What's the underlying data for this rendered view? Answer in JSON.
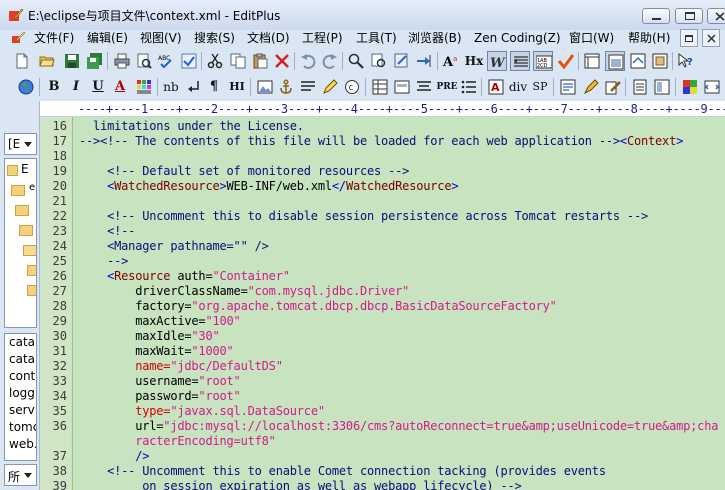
{
  "window": {
    "title": "E:\\eclipse与项目文件\\context.xml - EditPlus"
  },
  "menu": [
    "文件(F)",
    "编辑(E)",
    "视图(V)",
    "搜索(S)",
    "文档(D)",
    "工程(P)",
    "工具(T)",
    "浏览器(B)",
    "Zen Coding(Z)",
    "窗口(W)",
    "帮助(H)"
  ],
  "toolbar2_text": {
    "bold": "B",
    "italic": "I",
    "underline": "U",
    "nb": "nb",
    "para": "¶",
    "hi": "HI",
    "pre": "PRE",
    "div": "div",
    "sp": "SP",
    "hx": "Hx",
    "a": "A"
  },
  "left_panel": {
    "drive_combo": "[E",
    "filter_combo": "所",
    "tree_items": [
      "E",
      "e",
      "",
      "",
      "",
      "",
      ""
    ],
    "files": [
      "catal",
      "catal",
      "cont",
      "logg",
      "serv",
      "tomc",
      "web."
    ]
  },
  "ruler": "----+----1----+----2----+----3----+----4----+----5----+----6----+----7----+----8----+----9----",
  "editor": {
    "lines": [
      {
        "n": "16",
        "segs": [
          {
            "c": "c-com",
            "t": "  limitations under the License."
          }
        ]
      },
      {
        "n": "17",
        "segs": [
          {
            "c": "c-com",
            "t": "--><!-- The contents of this file will be loaded for each web application -->"
          },
          {
            "c": "c-brk",
            "t": "<"
          },
          {
            "c": "c-tag",
            "t": "Context"
          },
          {
            "c": "c-brk",
            "t": ">"
          }
        ]
      },
      {
        "n": "18",
        "segs": []
      },
      {
        "n": "19",
        "segs": [
          {
            "c": "c-com",
            "t": "    <!-- Default set of monitored resources -->"
          }
        ]
      },
      {
        "n": "20",
        "segs": [
          {
            "c": "c-brk",
            "t": "    <"
          },
          {
            "c": "c-tag",
            "t": "WatchedResource"
          },
          {
            "c": "c-brk",
            "t": ">"
          },
          {
            "c": "c-tagdk",
            "t": "WEB-INF/web.xml"
          },
          {
            "c": "c-brk",
            "t": "</"
          },
          {
            "c": "c-tag",
            "t": "WatchedResource"
          },
          {
            "c": "c-brk",
            "t": ">"
          }
        ]
      },
      {
        "n": "21",
        "segs": []
      },
      {
        "n": "22",
        "segs": [
          {
            "c": "c-com",
            "t": "    <!-- Uncomment this to disable session persistence across Tomcat restarts -->"
          }
        ]
      },
      {
        "n": "23",
        "segs": [
          {
            "c": "c-com",
            "t": "    <!--"
          }
        ]
      },
      {
        "n": "24",
        "segs": [
          {
            "c": "c-com",
            "t": "    <Manager pathname=\"\" />"
          }
        ]
      },
      {
        "n": "25",
        "segs": [
          {
            "c": "c-com",
            "t": "    -->"
          }
        ]
      },
      {
        "n": "26",
        "segs": [
          {
            "c": "c-brk",
            "t": "    <"
          },
          {
            "c": "c-tag",
            "t": "Resource"
          },
          {
            "c": "c-attr",
            "t": " auth="
          },
          {
            "c": "c-val",
            "t": "\"Container\""
          }
        ]
      },
      {
        "n": "27",
        "segs": [
          {
            "c": "c-attr",
            "t": "        driverClassName="
          },
          {
            "c": "c-val",
            "t": "\"com.mysql.jdbc.Driver\""
          }
        ]
      },
      {
        "n": "28",
        "segs": [
          {
            "c": "c-attr",
            "t": "        factory="
          },
          {
            "c": "c-val",
            "t": "\"org.apache.tomcat.dbcp.dbcp.BasicDataSourceFactory\""
          }
        ]
      },
      {
        "n": "29",
        "segs": [
          {
            "c": "c-attr",
            "t": "        maxActive="
          },
          {
            "c": "c-val",
            "t": "\"100\""
          }
        ]
      },
      {
        "n": "30",
        "segs": [
          {
            "c": "c-attr",
            "t": "        maxIdle="
          },
          {
            "c": "c-val",
            "t": "\"30\""
          }
        ]
      },
      {
        "n": "31",
        "segs": [
          {
            "c": "c-attr",
            "t": "        maxWait="
          },
          {
            "c": "c-val",
            "t": "\"1000\""
          }
        ]
      },
      {
        "n": "32",
        "segs": [
          {
            "c": "c-red",
            "t": "        name="
          },
          {
            "c": "c-val",
            "t": "\"jdbc/DefaultDS\""
          }
        ]
      },
      {
        "n": "33",
        "segs": [
          {
            "c": "c-attr",
            "t": "        username="
          },
          {
            "c": "c-val",
            "t": "\"root\""
          }
        ]
      },
      {
        "n": "34",
        "segs": [
          {
            "c": "c-attr",
            "t": "        password="
          },
          {
            "c": "c-val",
            "t": "\"root\""
          }
        ]
      },
      {
        "n": "35",
        "segs": [
          {
            "c": "c-red",
            "t": "        type="
          },
          {
            "c": "c-val",
            "t": "\"javax.sql.DataSource\""
          }
        ]
      },
      {
        "n": "36",
        "segs": [
          {
            "c": "c-attr",
            "t": "        url="
          },
          {
            "c": "c-val",
            "t": "\"jdbc:mysql://localhost:3306/cms?autoReconnect=true&amp;useUnicode=true&amp;cha"
          }
        ]
      },
      {
        "n": "",
        "segs": [
          {
            "c": "c-val",
            "t": "        racterEncoding=utf8\""
          }
        ]
      },
      {
        "n": "37",
        "segs": [
          {
            "c": "c-brk",
            "t": "        />"
          }
        ]
      },
      {
        "n": "38",
        "segs": [
          {
            "c": "c-com",
            "t": "    <!-- Uncomment this to enable Comet connection tacking (provides events"
          }
        ]
      },
      {
        "n": "39",
        "segs": [
          {
            "c": "c-com",
            "t": "         on session expiration as well as webapp lifecycle) -->"
          }
        ]
      }
    ]
  },
  "colors": {
    "editor_bg": "#c8e3c0",
    "comment": "#0c0c7a",
    "tag": "#7a0000",
    "value": "#d01c8b"
  }
}
